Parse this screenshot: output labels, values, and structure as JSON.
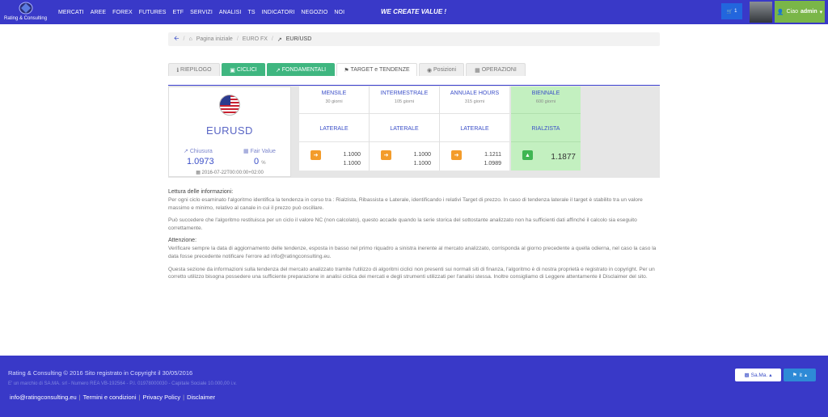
{
  "brand": {
    "logo_text": "Rating & Consulting"
  },
  "nav": {
    "menu": [
      "MERCATI",
      "AREE",
      "FOREX",
      "FUTURES",
      "ETF",
      "SERVIZI",
      "ANALISI",
      "TS",
      "INDICATORI",
      "NEGOZIO",
      "NOI"
    ],
    "slogan": "WE CREATE VALUE !",
    "cart_count": "1",
    "user_greeting": "Ciao",
    "user_name": "admin"
  },
  "breadcrumb": {
    "home": "Pagina iniziale",
    "section": "EURO FX",
    "current": "EUR/USD"
  },
  "tabs": [
    {
      "label": "RIEPILOGO",
      "icon": "info-icon"
    },
    {
      "label": "CICLICI",
      "icon": "bar-chart-icon"
    },
    {
      "label": "FONDAMENTALI",
      "icon": "line-chart-icon"
    },
    {
      "label": "TARGET e TENDENZE",
      "icon": "flag-icon"
    },
    {
      "label": "Posizioni",
      "icon": "bullseye-icon"
    },
    {
      "label": "OPERAZIONI",
      "icon": "calendar-icon"
    }
  ],
  "asset": {
    "name": "EURUSD",
    "close_label": "Chiusura",
    "close_value": "1.0973",
    "fair_label": "Fair Value",
    "fair_value": "0",
    "fair_unit": "%",
    "date": "2016-07-22T00:00:00+02:00"
  },
  "columns": [
    {
      "title": "MENSILE",
      "sub": "30 giorni",
      "trend": "LATERALE",
      "values": [
        "1.1000",
        "1.1000"
      ],
      "arrow": "right"
    },
    {
      "title": "INTERMESTRALE",
      "sub": "105 giorni",
      "trend": "LATERALE",
      "values": [
        "1.1000",
        "1.1000"
      ],
      "arrow": "right"
    },
    {
      "title": "ANNUALE HOURS",
      "sub": "315 giorni",
      "trend": "LATERALE",
      "values": [
        "1.1211",
        "1.0989"
      ],
      "arrow": "right"
    },
    {
      "title": "BIENNALE",
      "sub": "600 giorni",
      "trend": "RIALZISTA",
      "values": [
        "1.1877"
      ],
      "arrow": "up"
    }
  ],
  "info": {
    "heading1": "Lettura delle informazioni:",
    "p1": "Per ogni ciclo esaminato l'algoritmo identifica la tendenza in corso tra : Rialzista, Ribassista e Laterale, identificando i relativi Target di prezzo. In caso di tendenza laterale il target è stabilito tra un valore massimo e minimo, relativo al canale in cui il prezzo può oscillare.",
    "p2": "Può succedere che l'algoritmo restituisca per un ciclo il valore NC (non calcolato), questo accade quando la serie storica del sottostante analizzato non ha sufficienti dati affinché il calcolo sia eseguito correttamente.",
    "heading2": "Attenzione:",
    "p3": "Verificare sempre la data di aggiornamento delle tendenze, esposta in basso nel primo riquadro a sinistra inerente al mercato analizzato, corrisponda al giorno precedente a quella odierna, nel caso la caso la data fosse precedente notificare l'errore ad info@ratingconsulting.eu.",
    "p4": "Questa sezione da informazioni sulla tendenza del mercato analizzato tramite l'utilizzo di algoritmi ciclici non presenti sui normali siti di finanza, l'algoritmo è di nostra proprietà e registrato in copyright. Per un corretto utilizzo bisogna possedere una sufficiente preparazione in analisi ciclica dei mercati e degli strumenti utilizzati per l'analisi stessa. Inoltre consigliamo di Leggere attentamente il Disclaimer del sito."
  },
  "footer": {
    "copyright": "Rating & Consulting © 2016 Sito registrato in Copyright il 30/05/2016",
    "company": "E' un marchio di SA.MA. srl - Numero REA VB-192564 - P.I. 01978000030 - Capitale Sociale 10.000,00 i.v.",
    "links": [
      "info@ratingconsulting.eu",
      "Termini e condizioni",
      "Privacy Policy",
      "Disclaimer"
    ],
    "sama_label": "Sa.Ma.",
    "lang_label": "it"
  }
}
